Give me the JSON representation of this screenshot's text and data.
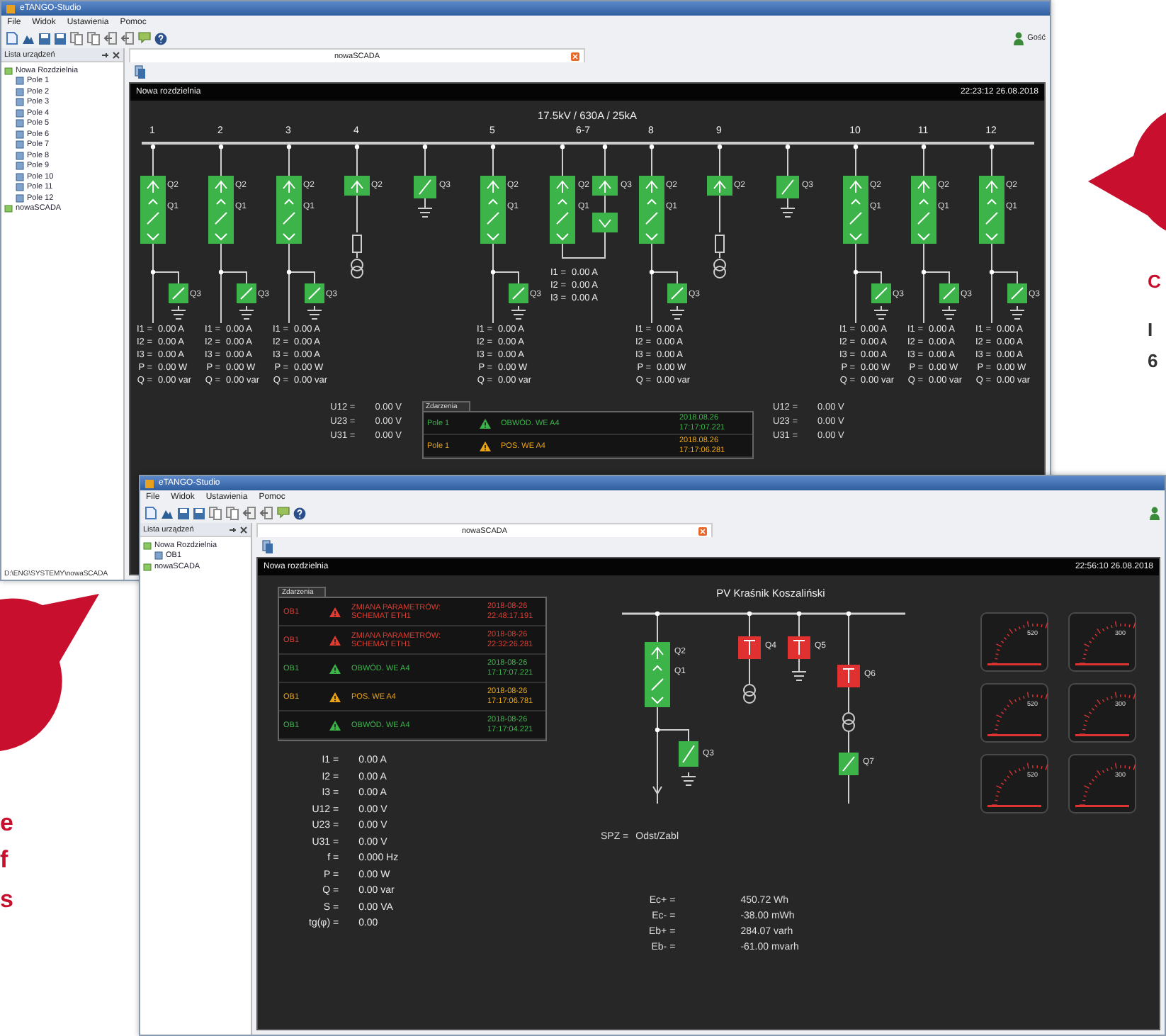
{
  "back_window": {
    "title": "eTANGO-Studio",
    "menu": [
      "File",
      "Widok",
      "Ustawienia",
      "Pomoc"
    ],
    "user": "Gość",
    "sidebar": {
      "title": "Lista urządzeń",
      "tree": [
        {
          "label": "Nowa Rozdzielnia",
          "children": [
            {
              "label": "Pole 1"
            },
            {
              "label": "Pole 2"
            },
            {
              "label": "Pole 3"
            },
            {
              "label": "Pole 4"
            },
            {
              "label": "Pole 5"
            },
            {
              "label": "Pole 6"
            },
            {
              "label": "Pole 7"
            },
            {
              "label": "Pole 8"
            },
            {
              "label": "Pole 9"
            },
            {
              "label": "Pole 10"
            },
            {
              "label": "Pole 11"
            },
            {
              "label": "Pole 12"
            }
          ]
        },
        {
          "label": "nowaSCADA"
        }
      ]
    },
    "tab": "nowaSCADA",
    "status_bar": "D:\\ENG\\SYSTEMY\\nowaSCADA",
    "panel": {
      "title": "Nowa rozdzielnia",
      "time": "22:23:12 26.08.2018",
      "rating": "17.5kV / 630A / 25kA",
      "bays": [
        {
          "kind": "feeder",
          "label": "1",
          "devices": [
            {
              "label": "Q2",
              "on": true
            },
            {
              "label": "Q1",
              "on": true
            },
            {
              "label": "Q3",
              "on": true
            }
          ],
          "measures": [
            {
              "name": "I1 =",
              "value": "0.00 A"
            },
            {
              "name": "I2 =",
              "value": "0.00 A"
            },
            {
              "name": "I3 =",
              "value": "0.00 A"
            },
            {
              "name": "P =",
              "value": "0.00 W"
            },
            {
              "name": "Q =",
              "value": "0.00 var"
            }
          ]
        },
        {
          "kind": "feeder",
          "label": "2",
          "devices": [
            {
              "label": "Q2",
              "on": true
            },
            {
              "label": "Q1",
              "on": true
            },
            {
              "label": "Q3",
              "on": true
            }
          ],
          "measures": [
            {
              "name": "I1 =",
              "value": "0.00 A"
            },
            {
              "name": "I2 =",
              "value": "0.00 A"
            },
            {
              "name": "I3 =",
              "value": "0.00 A"
            },
            {
              "name": "P =",
              "value": "0.00 W"
            },
            {
              "name": "Q =",
              "value": "0.00 var"
            }
          ]
        },
        {
          "kind": "feeder",
          "label": "3",
          "devices": [
            {
              "label": "Q2",
              "on": true
            },
            {
              "label": "Q1",
              "on": true
            },
            {
              "label": "Q3",
              "on": true
            }
          ],
          "measures": [
            {
              "name": "I1 =",
              "value": "0.00 A"
            },
            {
              "name": "I2 =",
              "value": "0.00 A"
            },
            {
              "name": "I3 =",
              "value": "0.00 A"
            },
            {
              "name": "P =",
              "value": "0.00 W"
            },
            {
              "name": "Q =",
              "value": "0.00 var"
            }
          ]
        },
        {
          "kind": "transformer",
          "label": "4",
          "devices": [
            {
              "label": "Q2",
              "on": true
            }
          ]
        },
        {
          "kind": "earth",
          "devices": [
            {
              "label": "Q3",
              "on": true
            }
          ]
        },
        {
          "kind": "feeder",
          "label": "5",
          "devices": [
            {
              "label": "Q2",
              "on": true
            },
            {
              "label": "Q1",
              "on": true
            },
            {
              "label": "Q3",
              "on": true
            }
          ],
          "measures": [
            {
              "name": "I1 =",
              "value": "0.00 A"
            },
            {
              "name": "I2 =",
              "value": "0.00 A"
            },
            {
              "name": "I3 =",
              "value": "0.00 A"
            },
            {
              "name": "P =",
              "value": "0.00 W"
            },
            {
              "name": "Q =",
              "value": "0.00 var"
            }
          ]
        },
        {
          "kind": "coupler",
          "label": "6-7",
          "devices": [
            {
              "label": "Q2",
              "on": true
            },
            {
              "label": "Q1",
              "on": true
            },
            {
              "label": "Q3",
              "on": true
            }
          ],
          "measures": [
            {
              "name": "I1 =",
              "value": "0.00 A"
            },
            {
              "name": "I2 =",
              "value": "0.00 A"
            },
            {
              "name": "I3 =",
              "value": "0.00 A"
            }
          ]
        },
        {
          "kind": "feeder",
          "label": "8",
          "devices": [
            {
              "label": "Q2",
              "on": true
            },
            {
              "label": "Q1",
              "on": true
            },
            {
              "label": "Q3",
              "on": true
            }
          ],
          "measures": [
            {
              "name": "I1 =",
              "value": "0.00 A"
            },
            {
              "name": "I2 =",
              "value": "0.00 A"
            },
            {
              "name": "I3 =",
              "value": "0.00 A"
            },
            {
              "name": "P =",
              "value": "0.00 W"
            },
            {
              "name": "Q =",
              "value": "0.00 var"
            }
          ]
        },
        {
          "kind": "transformer",
          "label": "9",
          "devices": [
            {
              "label": "Q2",
              "on": true
            }
          ]
        },
        {
          "kind": "earth",
          "devices": [
            {
              "label": "Q3",
              "on": true
            }
          ]
        },
        {
          "kind": "feeder",
          "label": "10",
          "devices": [
            {
              "label": "Q2",
              "on": true
            },
            {
              "label": "Q1",
              "on": true
            },
            {
              "label": "Q3",
              "on": true
            }
          ],
          "measures": [
            {
              "name": "I1 =",
              "value": "0.00 A"
            },
            {
              "name": "I2 =",
              "value": "0.00 A"
            },
            {
              "name": "I3 =",
              "value": "0.00 A"
            },
            {
              "name": "P =",
              "value": "0.00 W"
            },
            {
              "name": "Q =",
              "value": "0.00 var"
            }
          ]
        },
        {
          "kind": "feeder",
          "label": "11",
          "devices": [
            {
              "label": "Q2",
              "on": true
            },
            {
              "label": "Q1",
              "on": true
            },
            {
              "label": "Q3",
              "on": true
            }
          ],
          "measures": [
            {
              "name": "I1 =",
              "value": "0.00 A"
            },
            {
              "name": "I2 =",
              "value": "0.00 A"
            },
            {
              "name": "I3 =",
              "value": "0.00 A"
            },
            {
              "name": "P =",
              "value": "0.00 W"
            },
            {
              "name": "Q =",
              "value": "0.00 var"
            }
          ]
        },
        {
          "kind": "feeder",
          "label": "12",
          "devices": [
            {
              "label": "Q2",
              "on": true
            },
            {
              "label": "Q1",
              "on": true
            },
            {
              "label": "Q3",
              "on": true
            }
          ],
          "measures": [
            {
              "name": "I1 =",
              "value": "0.00 A"
            },
            {
              "name": "I2 =",
              "value": "0.00 A"
            },
            {
              "name": "I3 =",
              "value": "0.00 A"
            },
            {
              "name": "P =",
              "value": "0.00 W"
            },
            {
              "name": "Q =",
              "value": "0.00 var"
            }
          ]
        }
      ],
      "voltages_left": [
        {
          "name": "U12 =",
          "value": "0.00 V"
        },
        {
          "name": "U23 =",
          "value": "0.00 V"
        },
        {
          "name": "U31 =",
          "value": "0.00 V"
        }
      ],
      "events_tab": "Zdarzenia",
      "events": [
        {
          "source": "Pole 1",
          "message": "OBWÓD. WE A4",
          "time": "2018.08.26 17:17:07.221",
          "color": "#3cb44a"
        },
        {
          "source": "Pole 1",
          "message": "POS. WE A4",
          "time": "2018.08.26 17:17:06.281",
          "color": "#e8a317"
        }
      ],
      "voltages_right": [
        {
          "name": "U12 =",
          "value": "0.00 V"
        },
        {
          "name": "U23 =",
          "value": "0.00 V"
        },
        {
          "name": "U31 =",
          "value": "0.00 V"
        }
      ]
    }
  },
  "front_window": {
    "title": "eTANGO-Studio",
    "menu": [
      "File",
      "Widok",
      "Ustawienia",
      "Pomoc"
    ],
    "sidebar": {
      "title": "Lista urządzeń",
      "tree": [
        {
          "label": "Nowa Rozdzielnia",
          "children": [
            {
              "label": "OB1"
            }
          ]
        },
        {
          "label": "nowaSCADA"
        }
      ]
    },
    "tab": "nowaSCADA",
    "panel": {
      "title": "Nowa rozdzielnia",
      "time": "22:56:10 26.08.2018",
      "events_tab": "Zdarzenia",
      "events": [
        {
          "source": "OB1",
          "message": "ZMIANA PARAMETRÓW: SCHEMAT ETH1",
          "time": "2018-08-26 22:48:17.191",
          "color": "#e03c31"
        },
        {
          "source": "OB1",
          "message": "ZMIANA PARAMETRÓW: SCHEMAT ETH1",
          "time": "2018-08-26 22:32:26.281",
          "color": "#e03c31"
        },
        {
          "source": "OB1",
          "message": "OBWÓD. WE A4",
          "time": "2018-08-26 17:17:07.221",
          "color": "#3cb44a"
        },
        {
          "source": "OB1",
          "message": "POS. WE A4",
          "time": "2018-08-26 17:17:06.781",
          "color": "#e8a317"
        },
        {
          "source": "OB1",
          "message": "OBWÓD. WE A4",
          "time": "2018-08-26 17:17:04.221",
          "color": "#3cb44a"
        }
      ],
      "measures": [
        {
          "name": "I1 =",
          "value": "0.00 A"
        },
        {
          "name": "I2 =",
          "value": "0.00 A"
        },
        {
          "name": "I3 =",
          "value": "0.00 A"
        },
        {
          "name": "U12 =",
          "value": "0.00 V"
        },
        {
          "name": "U23 =",
          "value": "0.00 V"
        },
        {
          "name": "U31 =",
          "value": "0.00 V"
        },
        {
          "name": "f =",
          "value": "0.000 Hz"
        },
        {
          "name": "P =",
          "value": "0.00 W"
        },
        {
          "name": "Q =",
          "value": "0.00 var"
        },
        {
          "name": "S =",
          "value": "0.00 VA"
        },
        {
          "name": "tg(φ) =",
          "value": "0.00"
        }
      ],
      "diagram_title": "PV Kraśnik Koszaliński",
      "devices": [
        {
          "label": "Q2",
          "on": true
        },
        {
          "label": "Q1",
          "on": true
        },
        {
          "label": "Q3",
          "on": true
        },
        {
          "label": "Q4",
          "on": false
        },
        {
          "label": "Q5",
          "on": false
        },
        {
          "label": "Q6",
          "on": false
        },
        {
          "label": "Q7",
          "on": true
        }
      ],
      "spz": {
        "name": "SPZ =",
        "value": "Odst/Zabl"
      },
      "energy": [
        {
          "name": "Ec+ =",
          "value": "450.72 Wh"
        },
        {
          "name": "Ec- =",
          "value": "-38.00 mWh"
        },
        {
          "name": "Eb+ =",
          "value": "284.07 varh"
        },
        {
          "name": "Eb- =",
          "value": "-61.00 mvarh"
        }
      ],
      "gauges": [
        {
          "max": "520"
        },
        {
          "max": "300"
        },
        {
          "max": "520"
        },
        {
          "max": "300"
        },
        {
          "max": "520"
        },
        {
          "max": "300"
        }
      ]
    }
  },
  "left_margin_fragments": [
    {
      "text": "e",
      "kind": "accent"
    },
    {
      "text": "f",
      "kind": "accent"
    },
    {
      "text": "s",
      "kind": "accent"
    }
  ],
  "right_margin_fragments": [
    {
      "text": "C",
      "kind": "accent"
    },
    {
      "text": "I",
      "kind": "plain"
    },
    {
      "text": "6",
      "kind": "plain"
    }
  ]
}
